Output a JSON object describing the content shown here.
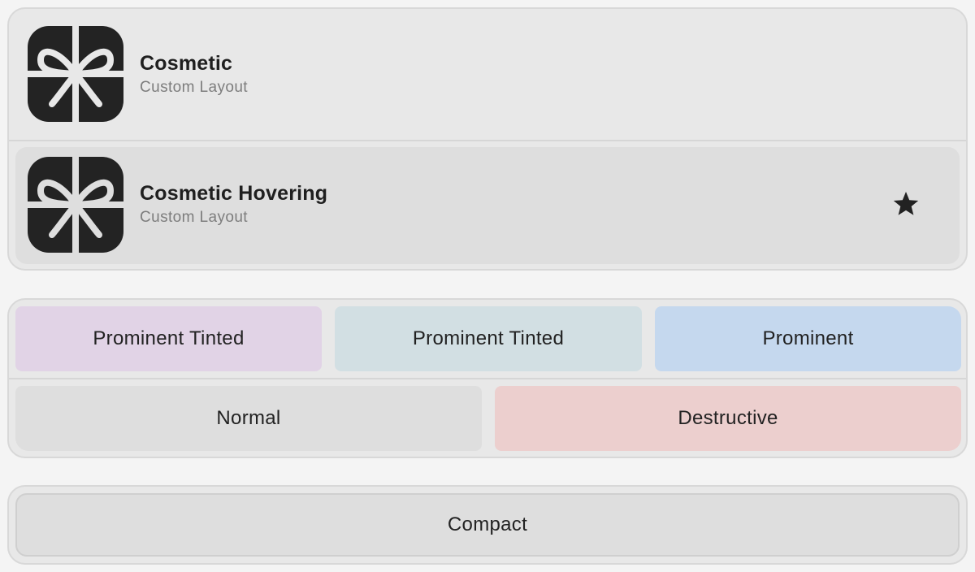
{
  "rows": [
    {
      "title": "Cosmetic",
      "subtitle": "Custom Layout",
      "icon": "gift-icon"
    },
    {
      "title": "Cosmetic Hovering",
      "subtitle": "Custom Layout",
      "icon": "gift-icon",
      "accessory": "star-icon"
    }
  ],
  "buttons": {
    "prominent_tinted_1": "Prominent Tinted",
    "prominent_tinted_2": "Prominent Tinted",
    "prominent": "Prominent",
    "normal": "Normal",
    "destructive": "Destructive",
    "compact": "Compact"
  },
  "colors": {
    "background": "#f4f4f4",
    "group": "#e8e8e8",
    "hover_row": "#dedede",
    "prominent_tinted_purple": "#e1d3e6",
    "prominent_tinted_teal": "#d2dfe3",
    "prominent_blue": "#c5d8ee",
    "normal_gray": "#dedede",
    "destructive_red": "#eccfce",
    "icon_dark": "#232323"
  }
}
